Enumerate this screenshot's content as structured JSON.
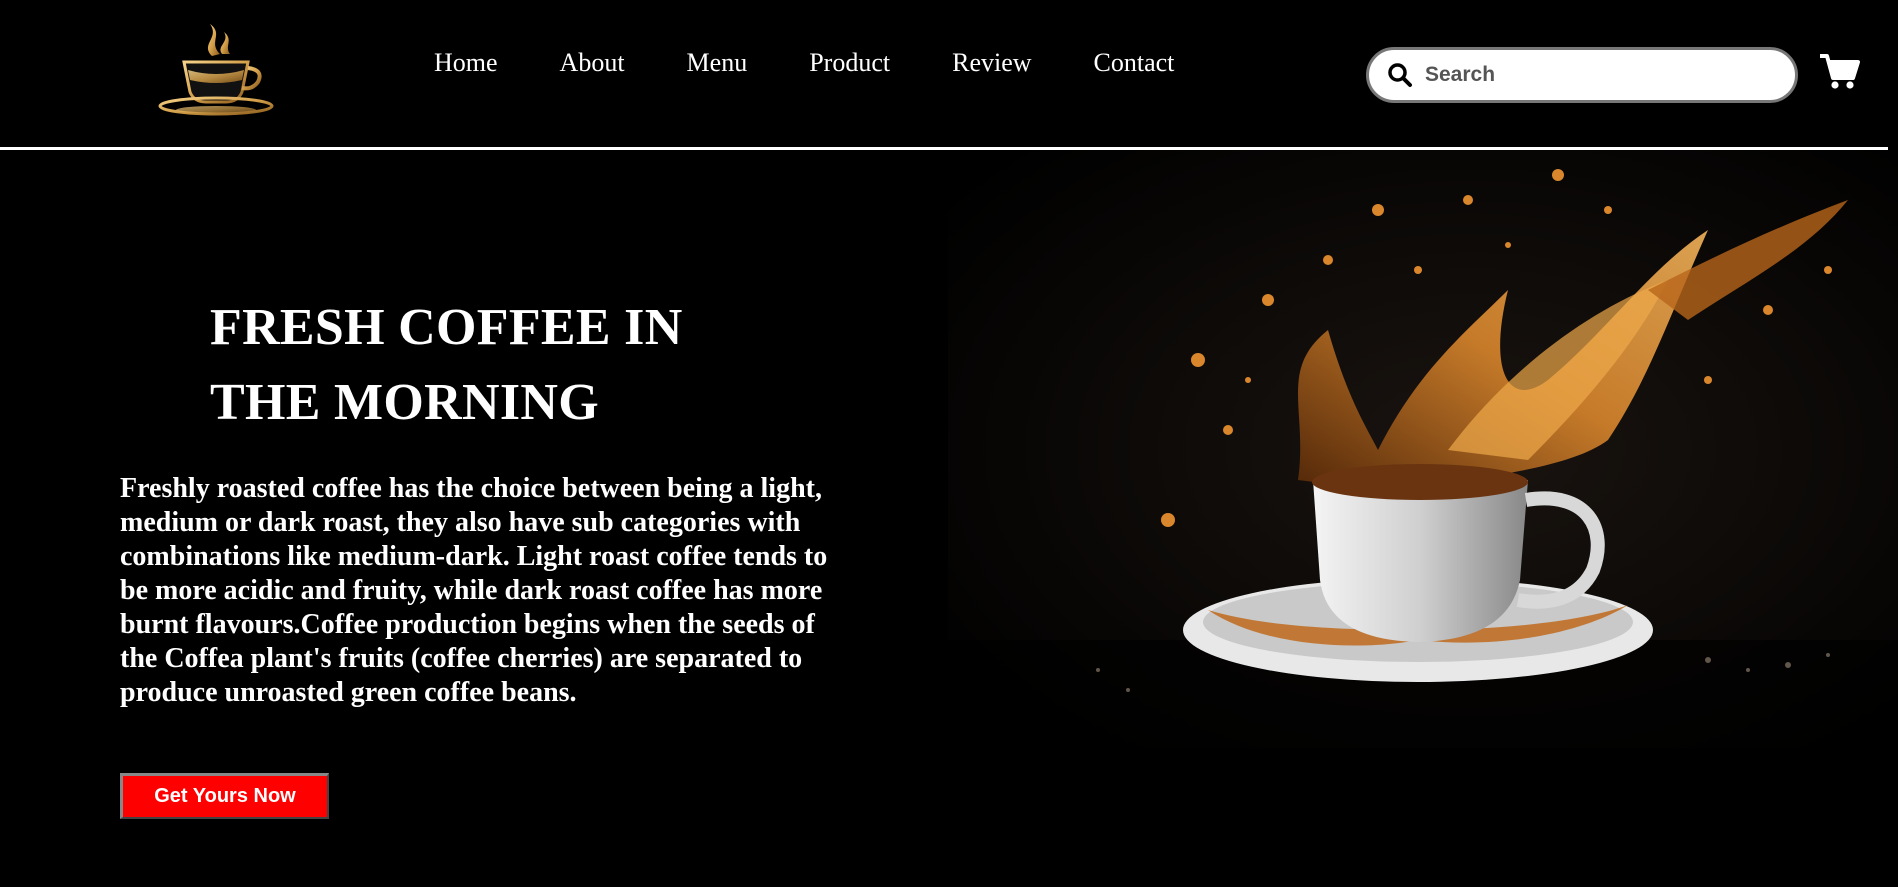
{
  "header": {
    "logo": {
      "icon": "coffee-cup-logo-icon"
    },
    "nav": [
      {
        "label": "Home"
      },
      {
        "label": "About"
      },
      {
        "label": "Menu"
      },
      {
        "label": "Product"
      },
      {
        "label": "Review"
      },
      {
        "label": "Contact"
      }
    ],
    "search": {
      "placeholder": "Search",
      "value": "",
      "icon": "search-icon"
    },
    "cart": {
      "icon": "shopping-cart-icon"
    }
  },
  "hero": {
    "title_line1": "FRESH COFFEE IN",
    "title_line2": "THE MORNING",
    "description": "Freshly roasted coffee has the choice between being a light, medium or dark roast, they also have sub categories with combinations like medium-dark. Light roast coffee tends to be more acidic and fruity, while dark roast coffee has more burnt flavours.Coffee production begins when the seeds of the Coffea plant's fruits (coffee cherries) are separated to produce unroasted green coffee beans.",
    "cta_label": "Get Yours Now",
    "image": "coffee-splash-cup-image"
  },
  "colors": {
    "background": "#000000",
    "text": "#ffffff",
    "accent": "#ff0000",
    "logo_gold": "#d4a04a",
    "coffee": "#b8651a"
  }
}
